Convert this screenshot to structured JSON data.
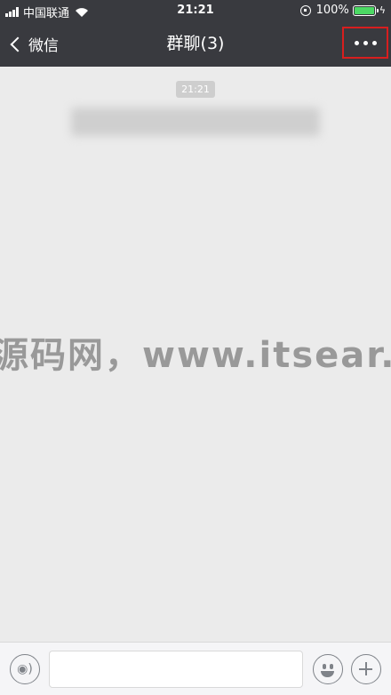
{
  "status_bar": {
    "carrier": "中国联通",
    "time": "21:21",
    "battery_percent": "100%"
  },
  "nav": {
    "back_label": "微信",
    "title": "群聊(3)",
    "more_icon": "more-dots-icon"
  },
  "chat": {
    "timestamp": "21:21",
    "watermark": "源码网，www.itsear.c"
  },
  "input_bar": {
    "voice_icon": "voice-icon",
    "emoji_icon": "emoji-icon",
    "plus_icon": "plus-icon",
    "text_value": ""
  },
  "colors": {
    "header_bg": "#393a3f",
    "chat_bg": "#ebebeb",
    "highlight_border": "#d81e1e",
    "battery_green": "#4cd964"
  }
}
